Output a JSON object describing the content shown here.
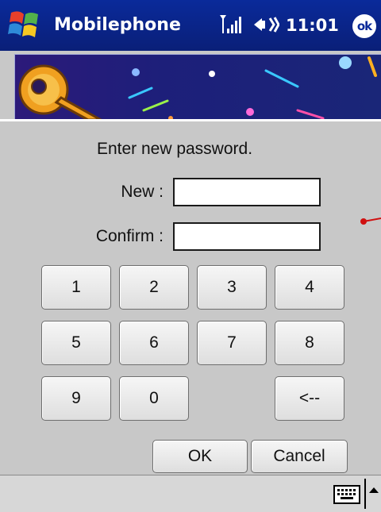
{
  "titlebar": {
    "app_title": "Mobilephone",
    "time": "11:01",
    "ok_label": "ok",
    "icons": [
      "windows-start-icon",
      "signal-icon",
      "speaker-icon"
    ]
  },
  "banner": {
    "icon": "key-icon"
  },
  "form": {
    "prompt": "Enter new password.",
    "new_label": "New :",
    "new_value": "",
    "confirm_label": "Confirm :",
    "confirm_value": ""
  },
  "keypad": {
    "keys": [
      "1",
      "2",
      "3",
      "4",
      "5",
      "6",
      "7",
      "8",
      "9",
      "0",
      "<--"
    ]
  },
  "buttons": {
    "ok": "OK",
    "cancel": "Cancel"
  },
  "menubar": {
    "icons": [
      "keyboard-icon",
      "sip-arrow-icon"
    ]
  },
  "colors": {
    "titlebar": "#0a2a9a",
    "background": "#c8c8c8",
    "pointer": "#d01010"
  }
}
